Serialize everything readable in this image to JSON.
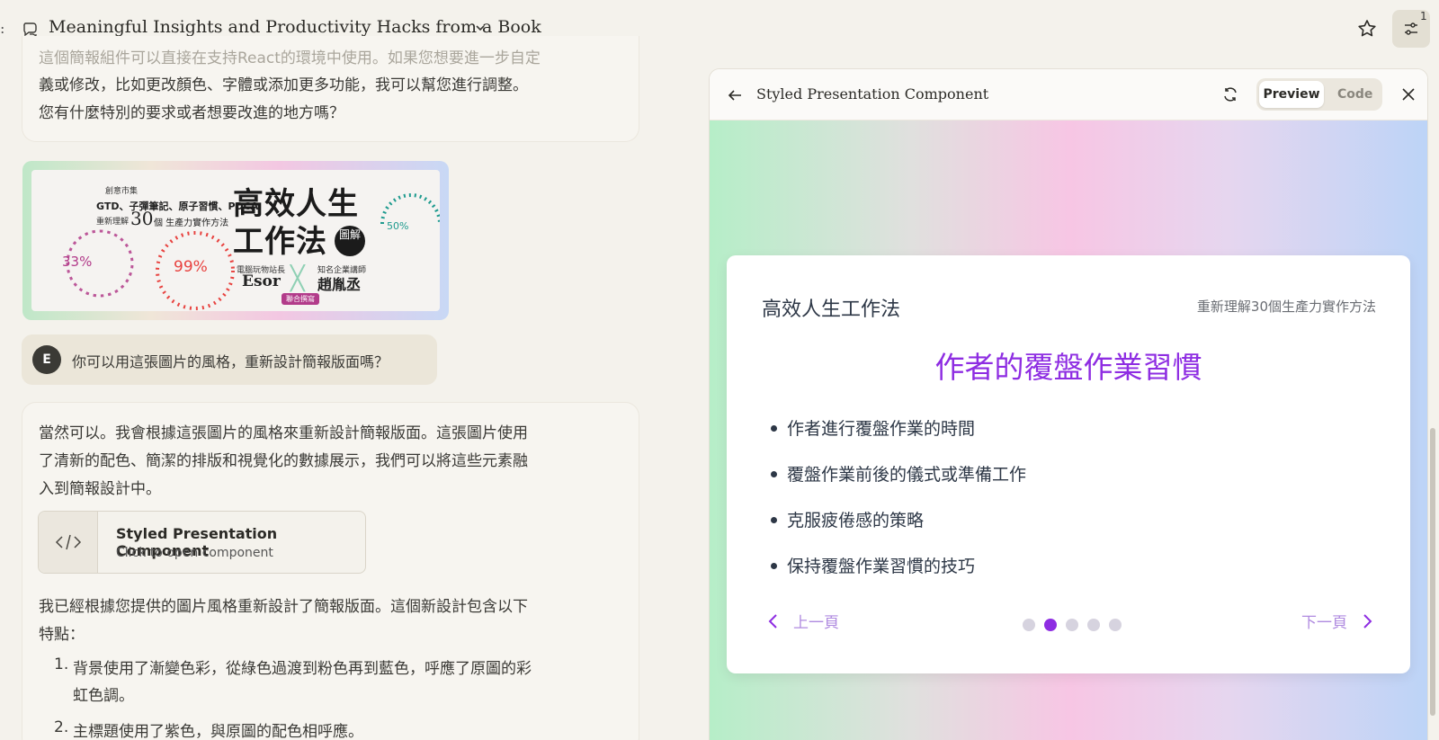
{
  "header": {
    "title": "Meaningful Insights and Productivity Hacks from a Book",
    "settings_badge": "1"
  },
  "chat": {
    "prev_message_lines": [
      "這個簡報組件可以直接在支持React的環境中使用。如果您想要進一步自定",
      "義或修改，比如更改顏色、字體或添加更多功能，我可以幫您進行調整。",
      "您有什麼特別的要求或者想要改進的地方嗎？"
    ],
    "book_image": {
      "publisher": "創意市集",
      "tagline": "GTD、子彈筆記、原子習慣、PDCA",
      "tagline2_pre": "重新理解",
      "tagline2_num": "30",
      "tagline2_post": "個 生產力實作方法",
      "title_line1": "高效人生",
      "title_line2": "工作法",
      "title_badge": "圖解",
      "author1_role": "電腦玩物站長",
      "author1_name": "Esor",
      "author2_role": "知名企業講師",
      "author2_name": "趙胤丞",
      "coauthor_tag": "聯合撰寫",
      "pct_left": "33%",
      "pct_center": "99%",
      "pct_right": "50%"
    },
    "user_avatar": "E",
    "user_message": "你可以用這張圖片的風格，重新設計簡報版面嗎？",
    "reply_lines": [
      "當然可以。我會根據這張圖片的風格來重新設計簡報版面。這張圖片使用",
      "了清新的配色、簡潔的排版和視覺化的數據展示，我們可以將這些元素融",
      "入到簡報設計中。"
    ],
    "component_card": {
      "title": "Styled Presentation Component",
      "subtitle": "Click to open component"
    },
    "after_lines": [
      "我已經根據您提供的圖片風格重新設計了簡報版面。這個新設計包含以下",
      "特點："
    ],
    "list": [
      {
        "num": "1.",
        "lines": [
          "背景使用了漸變色彩，從綠色過渡到粉色再到藍色，呼應了原圖的彩",
          "虹色調。"
        ]
      },
      {
        "num": "2.",
        "lines": [
          "主標題使用了紫色，與原圖的配色相呼應。"
        ]
      }
    ]
  },
  "panel": {
    "title": "Styled Presentation Component",
    "tab_preview": "Preview",
    "tab_code": "Code",
    "slide": {
      "title": "高效人生工作法",
      "subtitle": "重新理解30個生產力實作方法",
      "heading": "作者的覆盤作業習慣",
      "bullets": [
        "作者進行覆盤作業的時間",
        "覆盤作業前後的儀式或準備工作",
        "克服疲倦感的策略",
        "保持覆盤作業習慣的技巧"
      ],
      "prev_label": "上一頁",
      "next_label": "下一頁",
      "dot_count": 5,
      "active_dot": 2
    }
  },
  "colors": {
    "accent_purple": "#8e2de2",
    "nav_purple": "#b08be0",
    "page_bg": "#f4f2ec"
  }
}
